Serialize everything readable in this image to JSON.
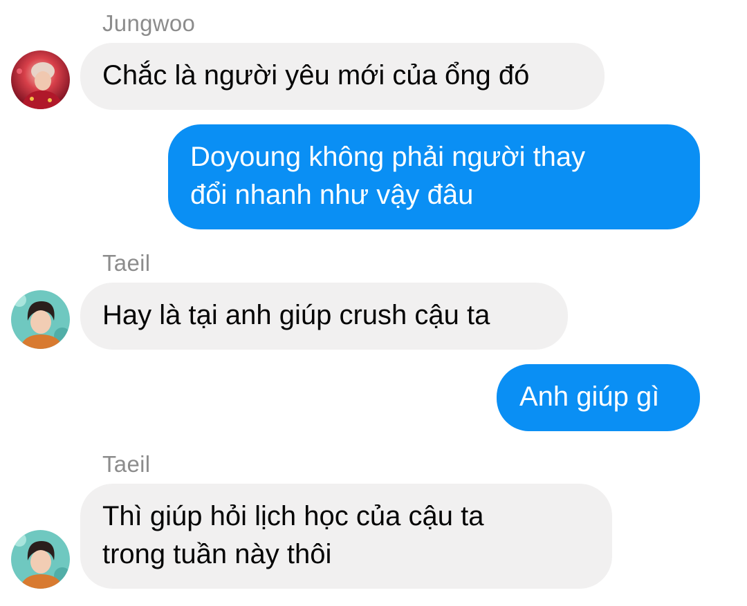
{
  "conversation": {
    "messages": [
      {
        "direction": "incoming",
        "sender": "Jungwoo",
        "lines": [
          "Chắc là người yêu mới của ổng đó"
        ],
        "avatar_icon": "profile-photo-red-icon"
      },
      {
        "direction": "outgoing",
        "lines": [
          "Doyoung không phải người thay",
          "đổi nhanh như vậy đâu"
        ]
      },
      {
        "direction": "incoming",
        "sender": "Taeil",
        "lines": [
          "Hay là tại anh giúp crush cậu ta"
        ],
        "avatar_icon": "profile-photo-teal-icon"
      },
      {
        "direction": "outgoing",
        "lines": [
          "Anh giúp gì"
        ]
      },
      {
        "direction": "incoming",
        "sender": "Taeil",
        "lines": [
          "Thì giúp hỏi lịch học của cậu ta",
          "trong tuần này thôi"
        ],
        "avatar_icon": "profile-photo-teal-icon"
      }
    ]
  },
  "colors": {
    "incoming_bubble": "#f1f0f0",
    "outgoing_bubble": "#0a8ff4",
    "sender_name": "#8c8c8c"
  }
}
